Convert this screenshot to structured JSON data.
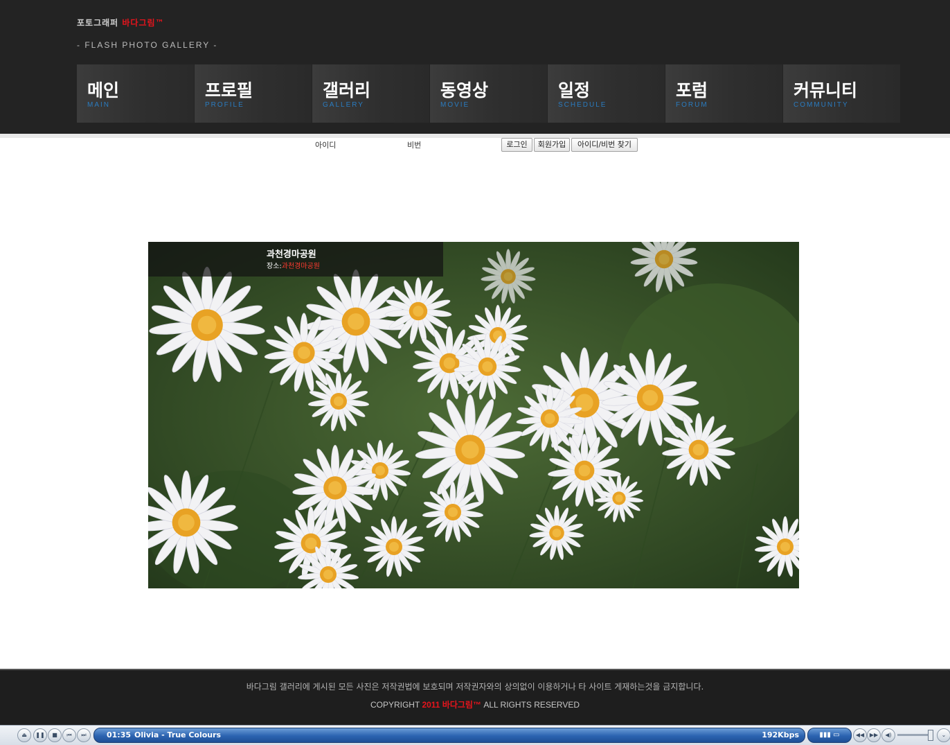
{
  "header": {
    "brand_prefix": "포토그래퍼",
    "brand_name": "바다그림™",
    "subtitle": "- FLASH PHOTO GALLERY -"
  },
  "nav": [
    {
      "kr": "메인",
      "en": "MAIN"
    },
    {
      "kr": "프로필",
      "en": "PROFILE"
    },
    {
      "kr": "갤러리",
      "en": "GALLERY"
    },
    {
      "kr": "동영상",
      "en": "MOVIE"
    },
    {
      "kr": "일정",
      "en": "SCHEDULE"
    },
    {
      "kr": "포럼",
      "en": "FORUM"
    },
    {
      "kr": "커뮤니티",
      "en": "COMMUNITY"
    }
  ],
  "login": {
    "id_label": "아이디",
    "pw_label": "비번",
    "login_button": "로그인",
    "join_button": "회원가입",
    "find_button": "아이디/비번 찾기"
  },
  "photo": {
    "title": "과천경마공원",
    "place_label": "장소:",
    "place_value": "과천경마공원"
  },
  "footer": {
    "notice": "바다그림 갤러리에 게시된 모든 사진은 저작권법에 보호되며 저작권자와의 상의없이 이용하거나 타 사이트 게재하는것을 금지합니다.",
    "copy_prefix": "COPYRIGHT",
    "copy_year_brand": "2011 바다그림™",
    "copy_suffix": "ALL RIGHTS RESERVED"
  },
  "player": {
    "time": "01:35",
    "track": "Olivia - True Colours",
    "bitrate": "192Kbps",
    "accent": "#2b63b0"
  },
  "colors": {
    "header_bg": "#232323",
    "brand_red": "#e8141c",
    "nav_en_blue": "#2a7bbf"
  }
}
